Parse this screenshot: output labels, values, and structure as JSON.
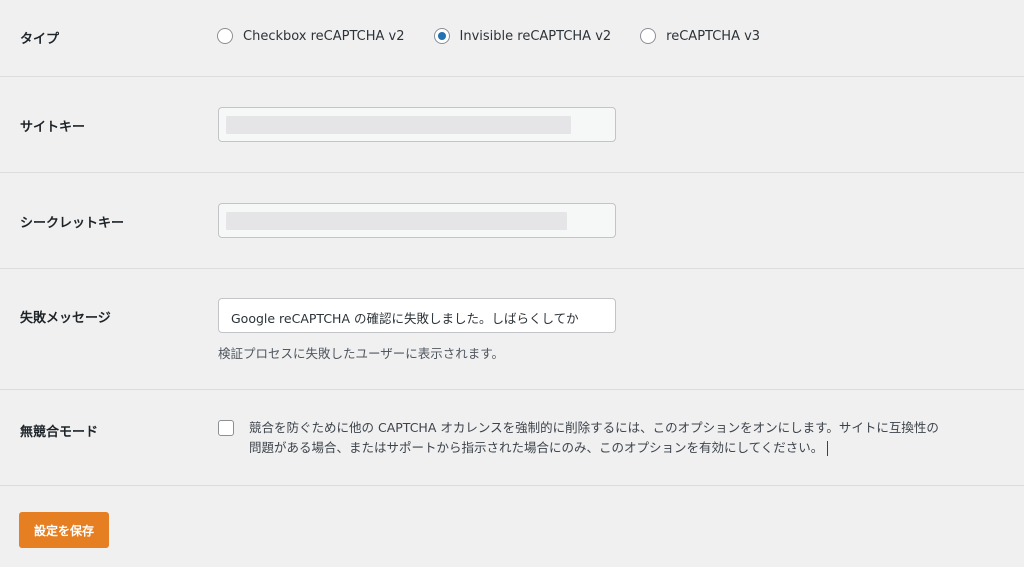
{
  "type_row": {
    "label": "タイプ",
    "options": [
      {
        "label": "Checkbox reCAPTCHA v2",
        "checked": false
      },
      {
        "label": "Invisible reCAPTCHA v2",
        "checked": true
      },
      {
        "label": "reCAPTCHA v3",
        "checked": false
      }
    ]
  },
  "site_key": {
    "label": "サイトキー"
  },
  "secret_key": {
    "label": "シークレットキー"
  },
  "failure_message": {
    "label": "失敗メッセージ",
    "value": "Google reCAPTCHA の確認に失敗しました。しばらくしてか",
    "description": "検証プロセスに失敗したユーザーに表示されます。"
  },
  "no_conflict": {
    "label": "無競合モード",
    "checked": false,
    "description_line1": "競合を防ぐために他の CAPTCHA オカレンスを強制的に削除するには、このオプションをオンにします。サイトに互換性の",
    "description_line2": "問題がある場合、またはサポートから指示された場合にのみ、このオプションを有効にしてください。"
  },
  "save_button": {
    "label": "設定を保存"
  },
  "colors": {
    "accent": "#2271b1",
    "save_button": "#e67e22",
    "background": "#f0f0f1"
  }
}
